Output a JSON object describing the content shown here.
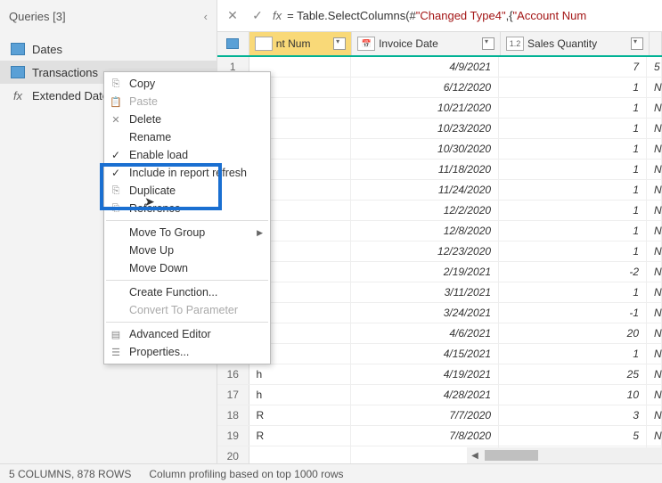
{
  "sidebar": {
    "title": "Queries [3]",
    "items": [
      {
        "label": "Dates",
        "icon": "table"
      },
      {
        "label": "Transactions",
        "icon": "table"
      },
      {
        "label": "Extended Date",
        "icon": "fx"
      }
    ]
  },
  "formula": {
    "text_prefix": "= Table.SelectColumns(#",
    "text_str": "\"Changed Type4\"",
    "text_mid": ",{",
    "text_str2": "\"Account Num"
  },
  "columns": [
    {
      "type": "",
      "name": "nt Num",
      "selected": true
    },
    {
      "type": "📅",
      "name": "Invoice Date"
    },
    {
      "type": "1.2",
      "name": "Sales Quantity"
    },
    {
      "type": "",
      "name": ""
    }
  ],
  "rows": [
    {
      "n": "1",
      "c1": "",
      "c2": "4/9/2021",
      "c3": "7",
      "c4": "5"
    },
    {
      "n": "",
      "c1": "",
      "c2": "6/12/2020",
      "c3": "1",
      "c4": "N"
    },
    {
      "n": "",
      "c1": "",
      "c2": "10/21/2020",
      "c3": "1",
      "c4": "N"
    },
    {
      "n": "",
      "c1": "",
      "c2": "10/23/2020",
      "c3": "1",
      "c4": "N"
    },
    {
      "n": "",
      "c1": "",
      "c2": "10/30/2020",
      "c3": "1",
      "c4": "N"
    },
    {
      "n": "",
      "c1": "",
      "c2": "11/18/2020",
      "c3": "1",
      "c4": "N"
    },
    {
      "n": "",
      "c1": "",
      "c2": "11/24/2020",
      "c3": "1",
      "c4": "N"
    },
    {
      "n": "",
      "c1": "",
      "c2": "12/2/2020",
      "c3": "1",
      "c4": "N"
    },
    {
      "n": "",
      "c1": "",
      "c2": "12/8/2020",
      "c3": "1",
      "c4": "N"
    },
    {
      "n": "",
      "c1": "",
      "c2": "12/23/2020",
      "c3": "1",
      "c4": "N"
    },
    {
      "n": "",
      "c1": "",
      "c2": "2/19/2021",
      "c3": "-2",
      "c4": "N"
    },
    {
      "n": "",
      "c1": "",
      "c2": "3/11/2021",
      "c3": "1",
      "c4": "N"
    },
    {
      "n": "",
      "c1": "",
      "c2": "3/24/2021",
      "c3": "-1",
      "c4": "N"
    },
    {
      "n": "",
      "c1": "",
      "c2": "4/6/2021",
      "c3": "20",
      "c4": "N"
    },
    {
      "n": "15",
      "c1": "h",
      "c2": "4/15/2021",
      "c3": "1",
      "c4": "N"
    },
    {
      "n": "16",
      "c1": "h",
      "c2": "4/19/2021",
      "c3": "25",
      "c4": "N"
    },
    {
      "n": "17",
      "c1": "h",
      "c2": "4/28/2021",
      "c3": "10",
      "c4": "N"
    },
    {
      "n": "18",
      "c1": "R",
      "c2": "7/7/2020",
      "c3": "3",
      "c4": "N"
    },
    {
      "n": "19",
      "c1": "R",
      "c2": "7/8/2020",
      "c3": "5",
      "c4": "N"
    },
    {
      "n": "20",
      "c1": "",
      "c2": "",
      "c3": "",
      "c4": ""
    }
  ],
  "context_menu": {
    "items": [
      {
        "label": "Copy",
        "icon": "⎘"
      },
      {
        "label": "Paste",
        "icon": "📋",
        "disabled": true
      },
      {
        "label": "Delete",
        "icon": "✕"
      },
      {
        "label": "Rename"
      },
      {
        "label": "Enable load",
        "check": true
      },
      {
        "label": "Include in report refresh",
        "check": true
      },
      {
        "label": "Duplicate",
        "icon": "⎘"
      },
      {
        "label": "Reference",
        "icon": "⎘"
      },
      {
        "sep": true
      },
      {
        "label": "Move To Group",
        "submenu": true
      },
      {
        "label": "Move Up"
      },
      {
        "label": "Move Down"
      },
      {
        "sep": true
      },
      {
        "label": "Create Function..."
      },
      {
        "label": "Convert To Parameter",
        "disabled": true
      },
      {
        "sep": true
      },
      {
        "label": "Advanced Editor",
        "icon": "▤"
      },
      {
        "label": "Properties...",
        "icon": "☰"
      }
    ]
  },
  "status": {
    "left": "5 COLUMNS, 878 ROWS",
    "right": "Column profiling based on top 1000 rows"
  }
}
